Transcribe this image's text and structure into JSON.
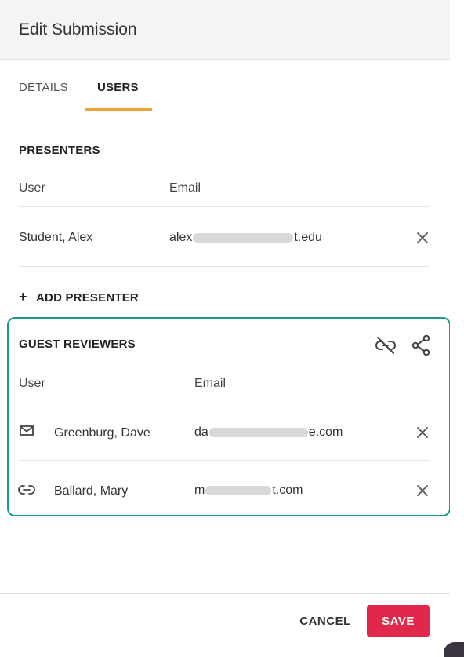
{
  "header": {
    "title": "Edit Submission"
  },
  "tabs": [
    {
      "label": "DETAILS",
      "active": false
    },
    {
      "label": "USERS",
      "active": true
    }
  ],
  "accent_colors": {
    "tab_underline": "#f0a33b",
    "guest_border": "#1a9b8e",
    "save_button": "#e0284a"
  },
  "presenters": {
    "title": "PRESENTERS",
    "columns": {
      "user": "User",
      "email": "Email"
    },
    "rows": [
      {
        "name": "Student, Alex",
        "email_start": "alex",
        "email_end": "t.edu",
        "remove_icon": "close-icon"
      }
    ],
    "add_label": "ADD PRESENTER"
  },
  "guest_reviewers": {
    "title": "GUEST REVIEWERS",
    "header_icons": [
      "unlink-icon",
      "share-icon"
    ],
    "columns": {
      "user": "User",
      "email": "Email"
    },
    "rows": [
      {
        "icon": "mail-icon",
        "name": "Greenburg, Dave",
        "email_start": "da",
        "email_end": "e.com",
        "remove_icon": "close-icon"
      },
      {
        "icon": "link-icon",
        "name": "Ballard, Mary",
        "email_start": "m",
        "email_end": "t.com",
        "remove_icon": "close-icon"
      }
    ]
  },
  "footer": {
    "cancel_label": "CANCEL",
    "save_label": "SAVE"
  }
}
